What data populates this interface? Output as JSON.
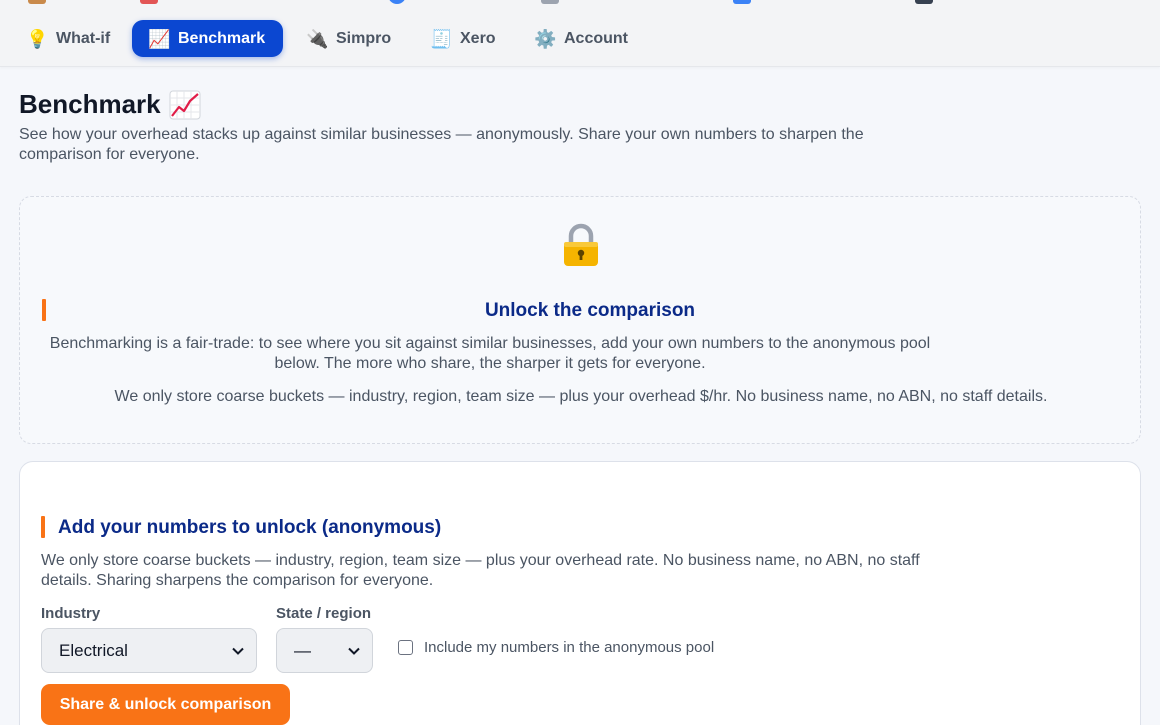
{
  "nav": {
    "tabs": [
      {
        "label": "What-if",
        "icon": "lightbulb-icon",
        "glyph": "💡",
        "active": false
      },
      {
        "label": "Benchmark",
        "icon": "chart-up-icon",
        "glyph": "📈",
        "active": true
      },
      {
        "label": "Simpro",
        "icon": "plug-icon",
        "glyph": "🔌",
        "active": false
      },
      {
        "label": "Xero",
        "icon": "receipt-icon",
        "glyph": "🧾",
        "active": false
      },
      {
        "label": "Account",
        "icon": "gear-icon",
        "glyph": "⚙️",
        "active": false
      }
    ],
    "active_color": "#0b47d1"
  },
  "page": {
    "title": "Benchmark",
    "subtitle": "See how your overhead stacks up against similar businesses — anonymously. Share your own numbers to sharpen the comparison for everyone."
  },
  "locked": {
    "icon": "lock-icon",
    "heading": "Unlock the comparison",
    "body": "Benchmarking is a fair-trade: to see where you sit against similar businesses, add your own numbers to the anonymous pool below. The more who share, the sharper it gets for everyone.",
    "privacy": "We only store coarse buckets — industry, region, team size — plus your overhead $/hr. No business name, no ABN, no staff details."
  },
  "share": {
    "heading": "Add your numbers to unlock (anonymous)",
    "body": "We only store coarse buckets — industry, region, team size — plus your overhead rate. No business name, no ABN, no staff details. Sharing sharpens the comparison for everyone.",
    "industry_label": "Industry",
    "industry_value": "Electrical",
    "state_label": "State / region",
    "state_value": "—",
    "consent_label": "Include my numbers in the anonymous pool",
    "consent_checked": false,
    "button_label": "Share & unlock comparison"
  },
  "colors": {
    "accent_orange": "#f97316",
    "heading_navy": "#0b2a88"
  }
}
